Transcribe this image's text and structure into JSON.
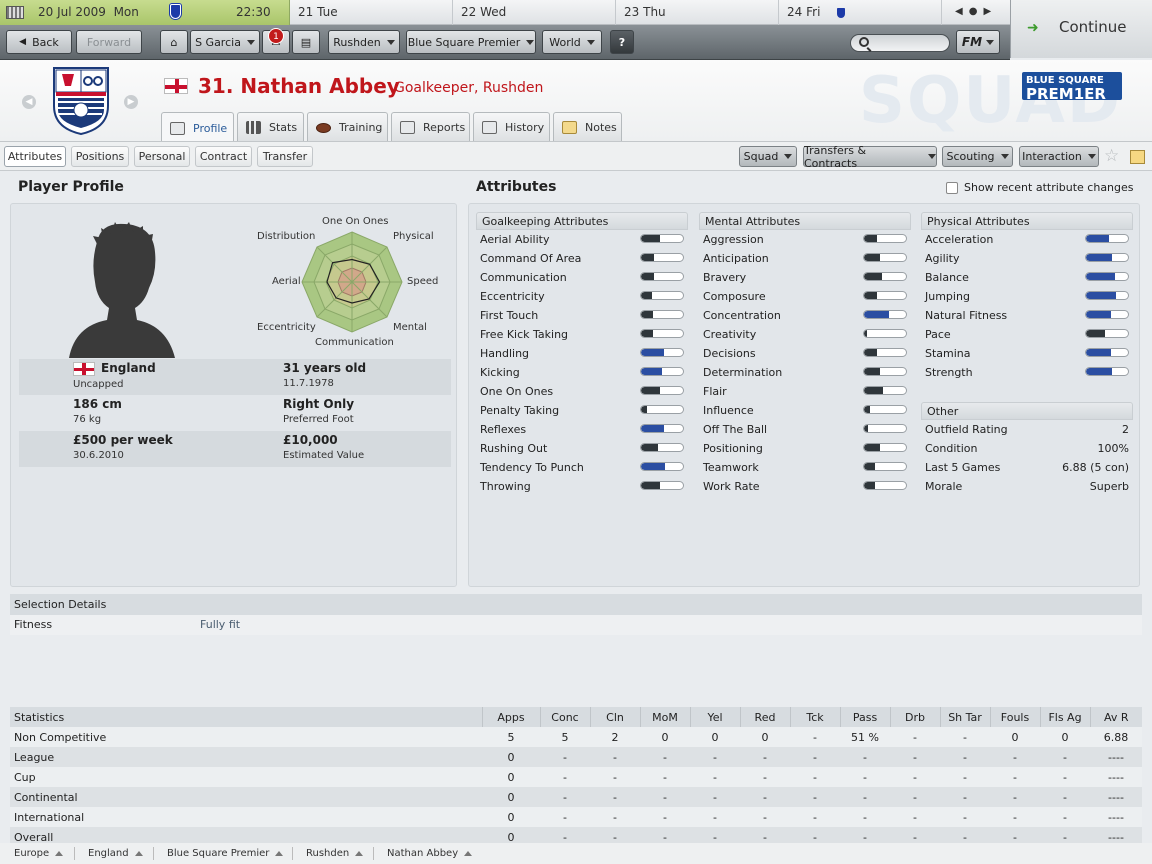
{
  "calendar": {
    "current_date": "20 Jul 2009",
    "current_day": "Mon",
    "time": "22:30",
    "days": [
      {
        "num": "21",
        "name": "Tue"
      },
      {
        "num": "22",
        "name": "Wed"
      },
      {
        "num": "23",
        "name": "Thu"
      },
      {
        "num": "24",
        "name": "Fri"
      }
    ]
  },
  "continue_label": "Continue",
  "toolbar": {
    "back": "Back",
    "forward": "Forward",
    "manager": "S Garcia",
    "inbox_count": "1",
    "club": "Rushden",
    "competition": "Blue Square Premier",
    "world": "World",
    "help": "?",
    "fm_menu": "FM"
  },
  "player": {
    "title": "31. Nathan Abbey",
    "role": "Goalkeeper, Rushden"
  },
  "league_logo": {
    "line1": "BLUE SQUARE",
    "line2": "PREM1ER"
  },
  "header_watermark": "SQUAD",
  "profile_tabs": [
    "Profile",
    "Stats",
    "Training",
    "Reports",
    "History",
    "Notes"
  ],
  "sub_tabs": [
    "Attributes",
    "Positions",
    "Personal",
    "Contract",
    "Transfer"
  ],
  "menu_buttons": [
    "Squad",
    "Transfers & Contracts",
    "Scouting",
    "Interaction"
  ],
  "profile": {
    "title": "Player Profile",
    "radar_labels": [
      "One On Ones",
      "Physical",
      "Speed",
      "Mental",
      "Communication",
      "Eccentricity",
      "Aerial",
      "Distribution"
    ],
    "radar_values": [
      0.45,
      0.5,
      0.55,
      0.48,
      0.42,
      0.45,
      0.5,
      0.55
    ],
    "nation": "England",
    "caps": "Uncapped",
    "age": "31 years old",
    "dob": "11.7.1978",
    "height": "186 cm",
    "weight": "76 kg",
    "foot": "Right Only",
    "foot_label": "Preferred Foot",
    "wage": "£500 per week",
    "contract_end": "30.6.2010",
    "value": "£10,000",
    "value_label": "Estimated Value"
  },
  "attributes": {
    "title": "Attributes",
    "show_changes_label": "Show recent attribute changes",
    "goalkeeping": {
      "header": "Goalkeeping Attributes",
      "items": [
        {
          "name": "Aerial Ability",
          "level": 0.45,
          "good": false
        },
        {
          "name": "Command Of Area",
          "level": 0.3,
          "good": false
        },
        {
          "name": "Communication",
          "level": 0.3,
          "good": false
        },
        {
          "name": "Eccentricity",
          "level": 0.25,
          "good": false
        },
        {
          "name": "First Touch",
          "level": 0.28,
          "good": false
        },
        {
          "name": "Free Kick Taking",
          "level": 0.28,
          "good": false
        },
        {
          "name": "Handling",
          "level": 0.55,
          "good": true
        },
        {
          "name": "Kicking",
          "level": 0.5,
          "good": true
        },
        {
          "name": "One On Ones",
          "level": 0.45,
          "good": false
        },
        {
          "name": "Penalty Taking",
          "level": 0.15,
          "good": false
        },
        {
          "name": "Reflexes",
          "level": 0.55,
          "good": true
        },
        {
          "name": "Rushing Out",
          "level": 0.4,
          "good": false
        },
        {
          "name": "Tendency To Punch",
          "level": 0.58,
          "good": true
        },
        {
          "name": "Throwing",
          "level": 0.45,
          "good": false
        }
      ]
    },
    "mental": {
      "header": "Mental Attributes",
      "items": [
        {
          "name": "Aggression",
          "level": 0.32,
          "good": false
        },
        {
          "name": "Anticipation",
          "level": 0.38,
          "good": false
        },
        {
          "name": "Bravery",
          "level": 0.42,
          "good": false
        },
        {
          "name": "Composure",
          "level": 0.32,
          "good": false
        },
        {
          "name": "Concentration",
          "level": 0.6,
          "good": true
        },
        {
          "name": "Creativity",
          "level": 0.06,
          "good": false
        },
        {
          "name": "Decisions",
          "level": 0.32,
          "good": false
        },
        {
          "name": "Determination",
          "level": 0.38,
          "good": false
        },
        {
          "name": "Flair",
          "level": 0.45,
          "good": false
        },
        {
          "name": "Influence",
          "level": 0.15,
          "good": false
        },
        {
          "name": "Off The Ball",
          "level": 0.1,
          "good": false
        },
        {
          "name": "Positioning",
          "level": 0.38,
          "good": false
        },
        {
          "name": "Teamwork",
          "level": 0.25,
          "good": false
        },
        {
          "name": "Work Rate",
          "level": 0.25,
          "good": false
        }
      ]
    },
    "physical": {
      "header": "Physical Attributes",
      "items": [
        {
          "name": "Acceleration",
          "level": 0.55,
          "good": true
        },
        {
          "name": "Agility",
          "level": 0.62,
          "good": true
        },
        {
          "name": "Balance",
          "level": 0.7,
          "good": true
        },
        {
          "name": "Jumping",
          "level": 0.72,
          "good": true
        },
        {
          "name": "Natural Fitness",
          "level": 0.6,
          "good": true
        },
        {
          "name": "Pace",
          "level": 0.45,
          "good": false
        },
        {
          "name": "Stamina",
          "level": 0.6,
          "good": true
        },
        {
          "name": "Strength",
          "level": 0.62,
          "good": true
        }
      ]
    },
    "other": {
      "header": "Other",
      "items": [
        {
          "name": "Outfield Rating",
          "value": "2"
        },
        {
          "name": "Condition",
          "value": "100%"
        },
        {
          "name": "Last 5 Games",
          "value": "6.88 (5 con)"
        },
        {
          "name": "Morale",
          "value": "Superb"
        }
      ]
    }
  },
  "selection": {
    "header": "Selection Details",
    "fitness_label": "Fitness",
    "fitness_value": "Fully fit"
  },
  "statistics": {
    "columns": [
      "Statistics",
      "Apps",
      "Conc",
      "Cln",
      "MoM",
      "Yel",
      "Red",
      "Tck",
      "Pass",
      "Drb",
      "Sh Tar",
      "Fouls",
      "Fls Ag",
      "Av R"
    ],
    "rows": [
      [
        "Non Competitive",
        "5",
        "5",
        "2",
        "0",
        "0",
        "0",
        "-",
        "51 %",
        "-",
        "-",
        "0",
        "0",
        "6.88"
      ],
      [
        "League",
        "0",
        "-",
        "-",
        "-",
        "-",
        "-",
        "-",
        "-",
        "-",
        "-",
        "-",
        "-",
        "----"
      ],
      [
        "Cup",
        "0",
        "-",
        "-",
        "-",
        "-",
        "-",
        "-",
        "-",
        "-",
        "-",
        "-",
        "-",
        "----"
      ],
      [
        "Continental",
        "0",
        "-",
        "-",
        "-",
        "-",
        "-",
        "-",
        "-",
        "-",
        "-",
        "-",
        "-",
        "----"
      ],
      [
        "International",
        "0",
        "-",
        "-",
        "-",
        "-",
        "-",
        "-",
        "-",
        "-",
        "-",
        "-",
        "-",
        "----"
      ],
      [
        "Overall",
        "0",
        "-",
        "-",
        "-",
        "-",
        "-",
        "-",
        "-",
        "-",
        "-",
        "-",
        "-",
        "----"
      ]
    ]
  },
  "breadcrumbs": [
    "Europe",
    "England",
    "Blue Square Premier",
    "Rushden",
    "Nathan Abbey"
  ]
}
